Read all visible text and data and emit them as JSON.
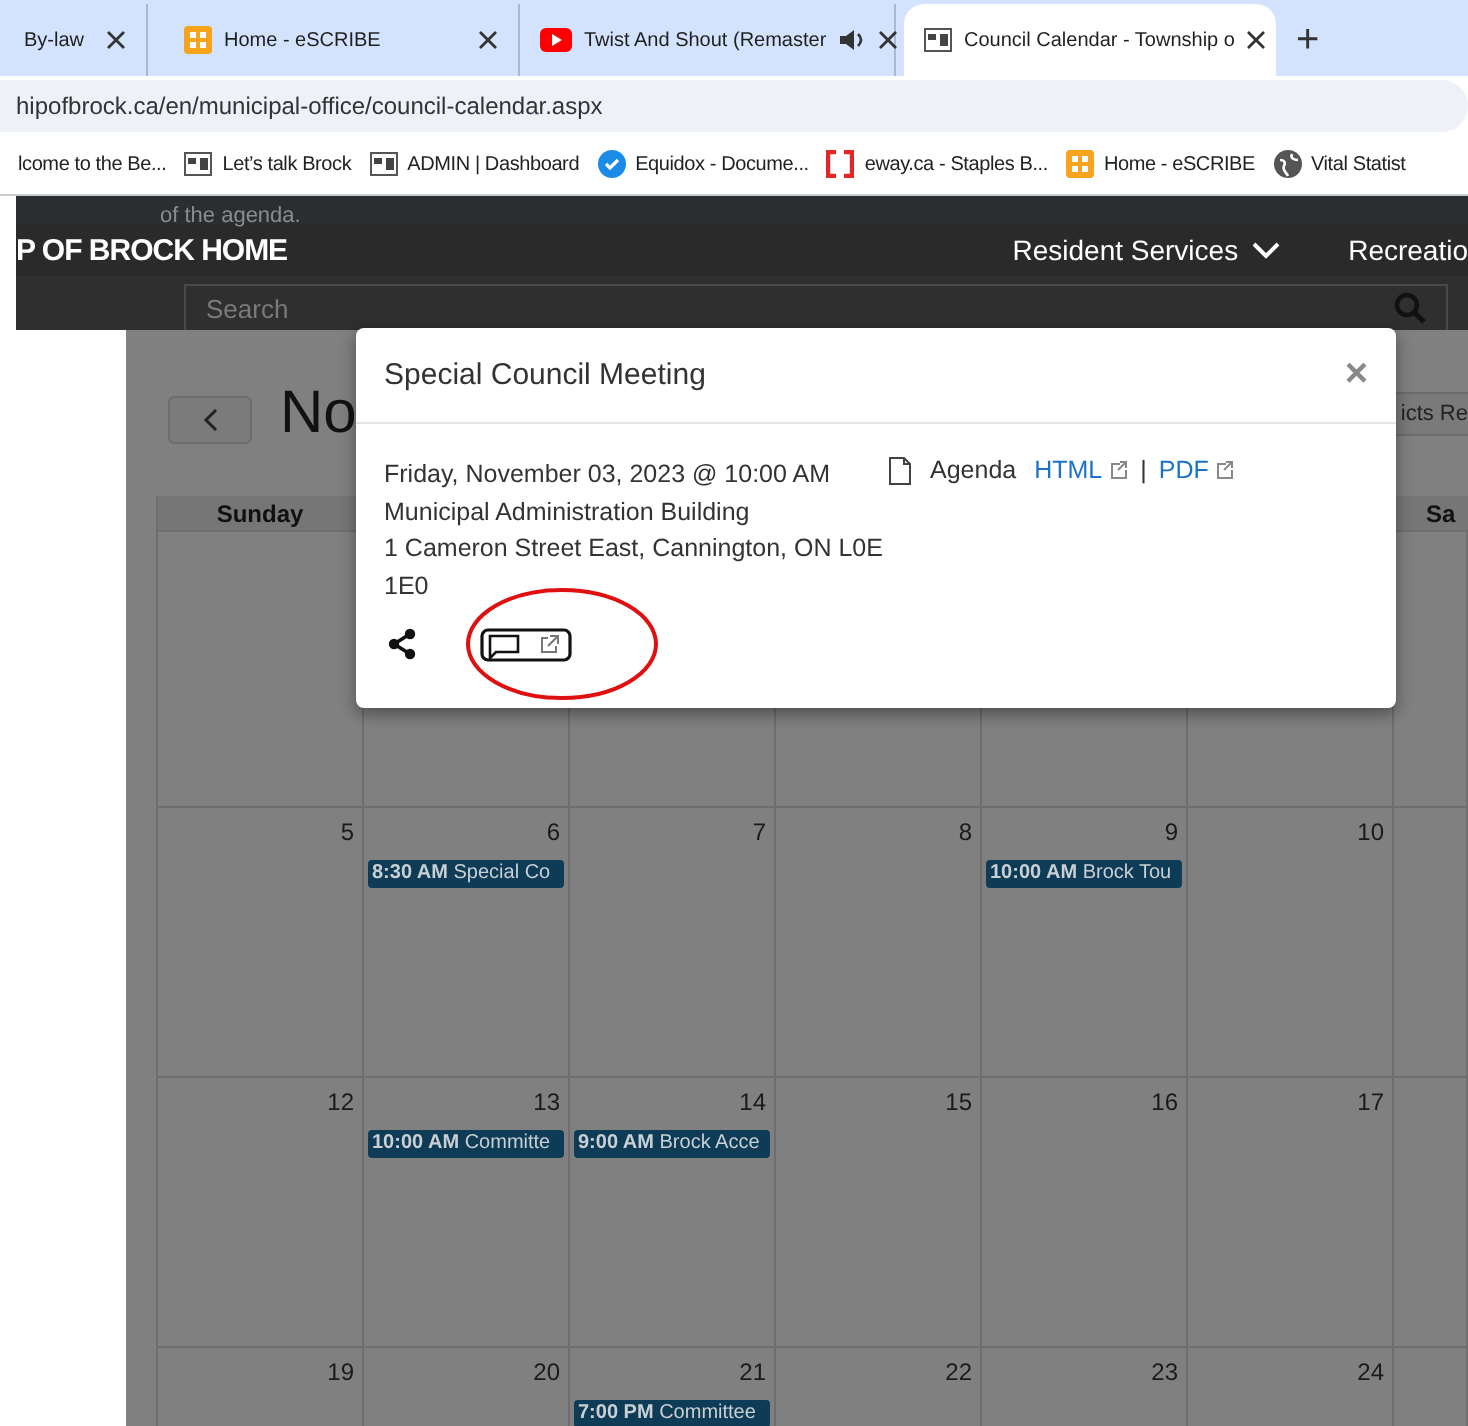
{
  "browser": {
    "tabs": [
      {
        "title": "By-law",
        "audio": false,
        "selected": false
      },
      {
        "title": "Home - eSCRIBE",
        "audio": false,
        "selected": false
      },
      {
        "title": "Twist And Shout (Remaster",
        "audio": true,
        "selected": false
      },
      {
        "title": "Council Calendar - Township o",
        "audio": false,
        "selected": true
      }
    ],
    "new_tab": "+",
    "address": "hipofbrock.ca/en/municipal-office/council-calendar.aspx",
    "bookmarks": [
      {
        "label": "lcome to the Be..."
      },
      {
        "label": "Let’s talk Brock"
      },
      {
        "label": "ADMIN | Dashboard"
      },
      {
        "label": "Equidox - Docume..."
      },
      {
        "label": "eway.ca - Staples B..."
      },
      {
        "label": "Home - eSCRIBE"
      },
      {
        "label": "Vital Statist"
      }
    ]
  },
  "page": {
    "intro_text": "of the agenda.",
    "site_title": "P OF BROCK HOME",
    "nav": [
      {
        "label": "Resident Services",
        "dropdown": true
      },
      {
        "label": "Recreatio",
        "dropdown": false
      }
    ],
    "search": {
      "placeholder": "Search"
    },
    "month_title": "No",
    "side_button": "icts Re",
    "weekdays": [
      "Sunday",
      "Sa"
    ],
    "weeks": [
      {
        "days": [
          {
            "date": "5"
          },
          {
            "date": "6",
            "events": [
              {
                "time": "8:30 AM",
                "title": "Special Co"
              }
            ]
          },
          {
            "date": "7"
          },
          {
            "date": "8"
          },
          {
            "date": "9",
            "events": [
              {
                "time": "10:00 AM",
                "title": "Brock Tou"
              }
            ]
          },
          {
            "date": "10"
          }
        ]
      },
      {
        "days": [
          {
            "date": "12"
          },
          {
            "date": "13",
            "events": [
              {
                "time": "10:00 AM",
                "title": "Committe"
              }
            ]
          },
          {
            "date": "14",
            "events": [
              {
                "time": "9:00 AM",
                "title": "Brock Acce"
              }
            ]
          },
          {
            "date": "15"
          },
          {
            "date": "16"
          },
          {
            "date": "17"
          }
        ]
      },
      {
        "days": [
          {
            "date": "19"
          },
          {
            "date": "20"
          },
          {
            "date": "21",
            "events": [
              {
                "time": "7:00 PM",
                "title": "Committee"
              }
            ]
          },
          {
            "date": "22"
          },
          {
            "date": "23"
          },
          {
            "date": "24"
          }
        ]
      }
    ]
  },
  "modal": {
    "title": "Special Council Meeting",
    "close": "×",
    "lines": [
      "Friday, November 03, 2023 @ 10:00 AM",
      "Municipal Administration Building",
      "1 Cameron Street East, Cannington, ON L0E",
      "1E0"
    ],
    "agenda": {
      "label": "Agenda",
      "links": [
        "HTML",
        "PDF"
      ],
      "separator": "|"
    },
    "annotation": {
      "kind": "ellipse"
    }
  }
}
